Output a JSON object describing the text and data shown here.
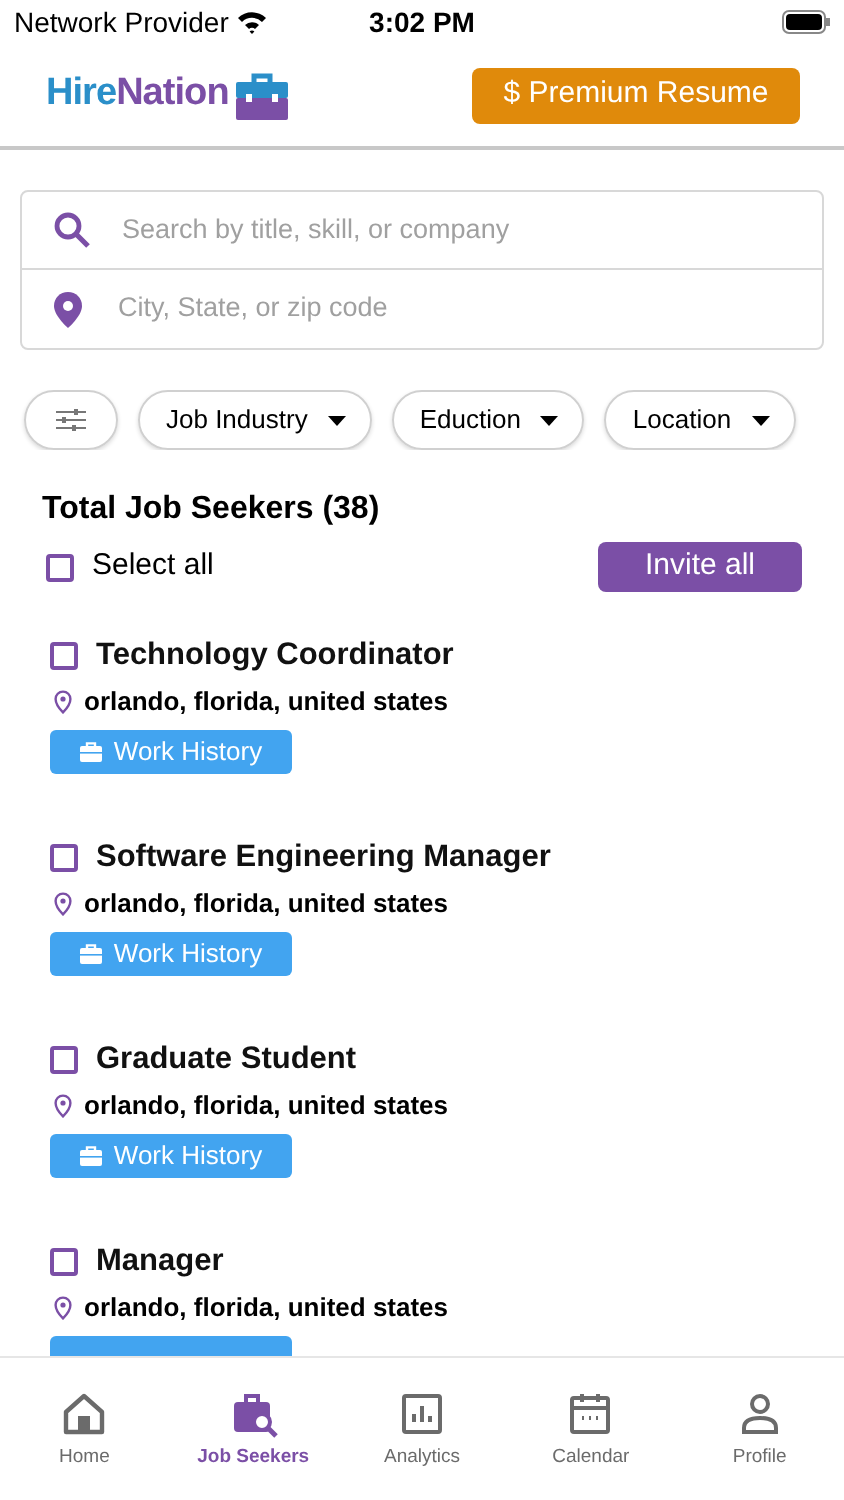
{
  "status_bar": {
    "carrier": "Network Provider",
    "time": "3:02 PM"
  },
  "header": {
    "logo_part_1": "Hire",
    "logo_part_2": "Nation",
    "premium_button": "$ Premium Resume"
  },
  "search": {
    "keyword_placeholder": "Search by title, skill, or company",
    "location_placeholder": "City, State, or zip code"
  },
  "filters": [
    {
      "label": "Job Industry"
    },
    {
      "label": "Eduction"
    },
    {
      "label": "Location"
    }
  ],
  "list_header": {
    "title": "Total Job Seekers (38)",
    "select_all": "Select all",
    "select_all_checked": false,
    "invite_button": "Invite all"
  },
  "job_seekers": [
    {
      "title": "Technology Coordinator",
      "location": "orlando, florida, united states",
      "checked": false,
      "button": "Work History"
    },
    {
      "title": "Software Engineering Manager",
      "location": "orlando, florida, united states",
      "checked": false,
      "button": "Work History"
    },
    {
      "title": "Graduate Student",
      "location": "orlando, florida, united states",
      "checked": false,
      "button": "Work History"
    },
    {
      "title": "Manager",
      "location": "orlando, florida, united states",
      "checked": false
    }
  ],
  "tab_bar": [
    {
      "label": "Home",
      "kind": "home",
      "selected": false
    },
    {
      "label": "Job Seekers",
      "kind": "seekers",
      "selected": true
    },
    {
      "label": "Analytics",
      "kind": "analytics",
      "selected": false
    },
    {
      "label": "Calendar",
      "kind": "calendar",
      "selected": false
    },
    {
      "label": "Profile",
      "kind": "profile",
      "selected": false
    }
  ]
}
